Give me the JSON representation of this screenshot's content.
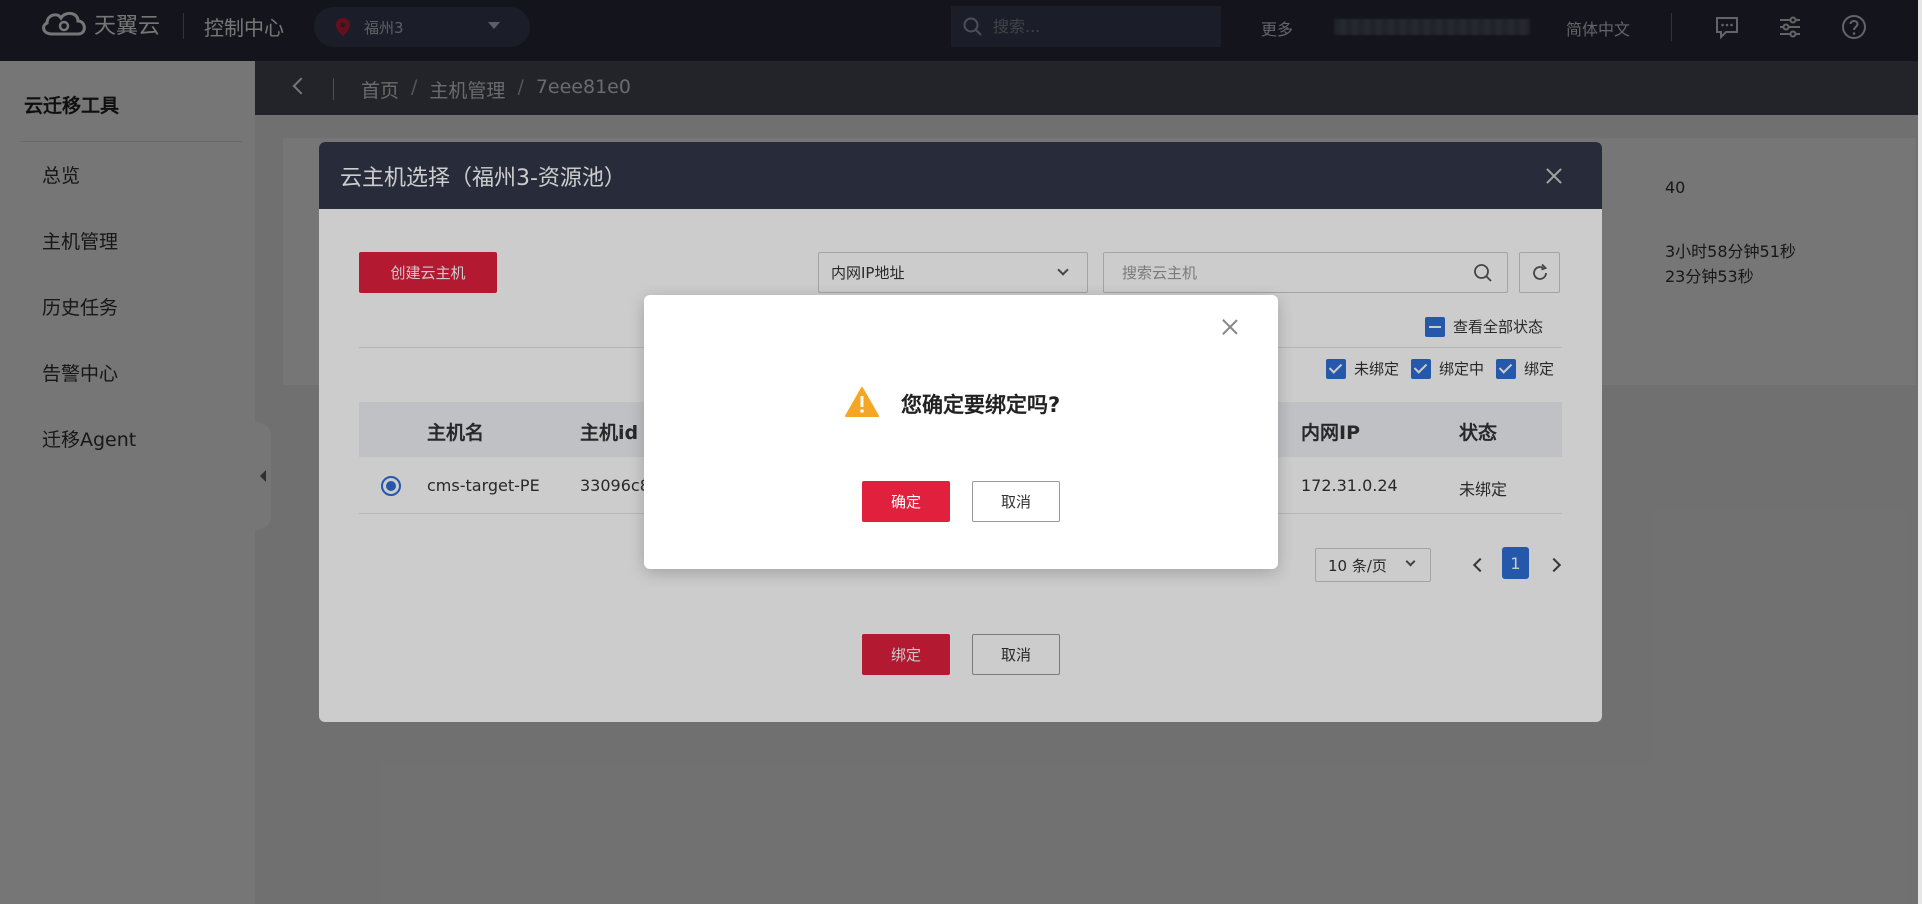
{
  "topbar": {
    "brand": "天翼云",
    "console": "控制中心",
    "region": "福州3",
    "search_placeholder": "搜索...",
    "more": "更多",
    "language": "简体中文"
  },
  "sidebar": {
    "title": "云迁移工具",
    "items": [
      {
        "label": "总览"
      },
      {
        "label": "主机管理"
      },
      {
        "label": "历史任务"
      },
      {
        "label": "告警中心"
      },
      {
        "label": "迁移Agent"
      }
    ]
  },
  "breadcrumb": [
    "首页",
    "主机管理",
    "7eee81e0"
  ],
  "background": {
    "value1": "40",
    "value2": "3小时58分钟51秒",
    "value3": "23分钟53秒"
  },
  "modal": {
    "title": "云主机选择（福州3-资源池）",
    "create_button": "创建云主机",
    "filter_select": "内网IP地址",
    "search_placeholder": "搜索云主机",
    "view_all_status": "查看全部状态",
    "status_filters": [
      "未绑定",
      "绑定中",
      "绑定"
    ],
    "columns": [
      "主机名",
      "主机id",
      "内网IP",
      "状态"
    ],
    "rows": [
      {
        "name": "cms-target-PE",
        "id": "33096c8",
        "ip": "172.31.0.24",
        "status": "未绑定"
      }
    ],
    "page_size": "10 条/页",
    "current_page": "1",
    "bind_button": "绑定",
    "cancel_button": "取消"
  },
  "confirm": {
    "message": "您确定要绑定吗?",
    "ok": "确定",
    "cancel": "取消"
  },
  "colors": {
    "topbar": "#2b2f3d",
    "primary_red": "#e0203c",
    "primary_blue": "#2f6fd6",
    "warning": "#f5a623"
  }
}
